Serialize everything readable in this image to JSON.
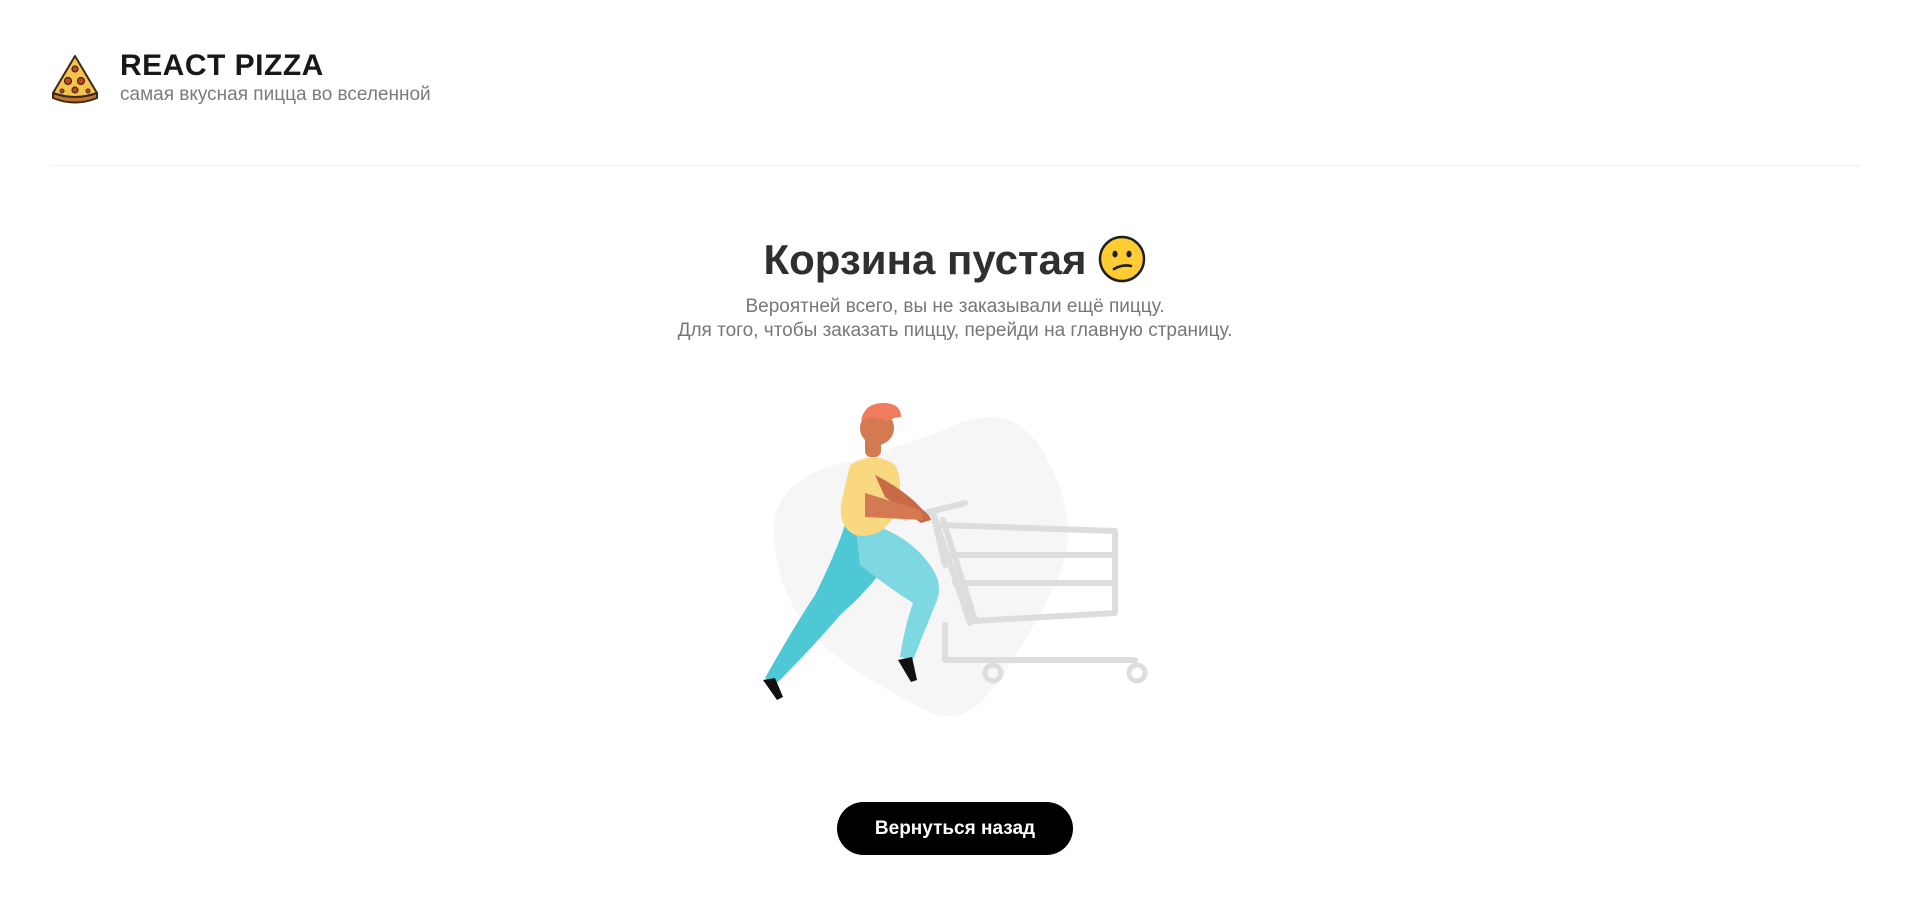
{
  "header": {
    "logo_icon": "pizza-slice-icon",
    "title": "REACT PIZZA",
    "subtitle": "самая вкусная пицца во вселенной"
  },
  "cart": {
    "title": "Корзина пустая",
    "title_icon": "confused-face-emoji-icon",
    "description_line1": "Вероятней всего, вы не заказывали ещё пиццу.",
    "description_line2": "Для того, чтобы заказать пиццу, перейди на главную страницу.",
    "illustration": "empty-cart-illustration",
    "back_button_label": "Вернуться назад"
  },
  "colors": {
    "background": "#ffffff",
    "title_text": "#2f2f2f",
    "muted_text": "#777777",
    "button_bg": "#000000",
    "button_text": "#ffffff"
  }
}
